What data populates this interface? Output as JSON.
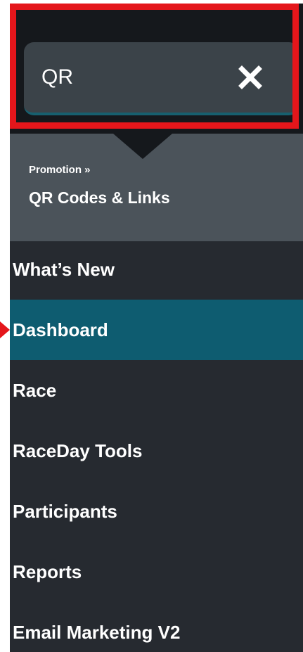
{
  "search": {
    "value": "QR",
    "clear_icon": "close-icon"
  },
  "search_result": {
    "path": "Promotion »",
    "title": "QR Codes & Links"
  },
  "menu": {
    "items": [
      {
        "label": "What’s New"
      },
      {
        "label": "Dashboard",
        "active": true
      },
      {
        "label": "Race"
      },
      {
        "label": "RaceDay Tools"
      },
      {
        "label": "Participants"
      },
      {
        "label": "Reports"
      },
      {
        "label": "Email Marketing V2"
      }
    ]
  },
  "colors": {
    "sidebar_bg": "#262a30",
    "search_bg": "#15181c",
    "result_bg": "#4b535a",
    "active_bg": "#0e5c70",
    "highlight": "#e4161b"
  }
}
